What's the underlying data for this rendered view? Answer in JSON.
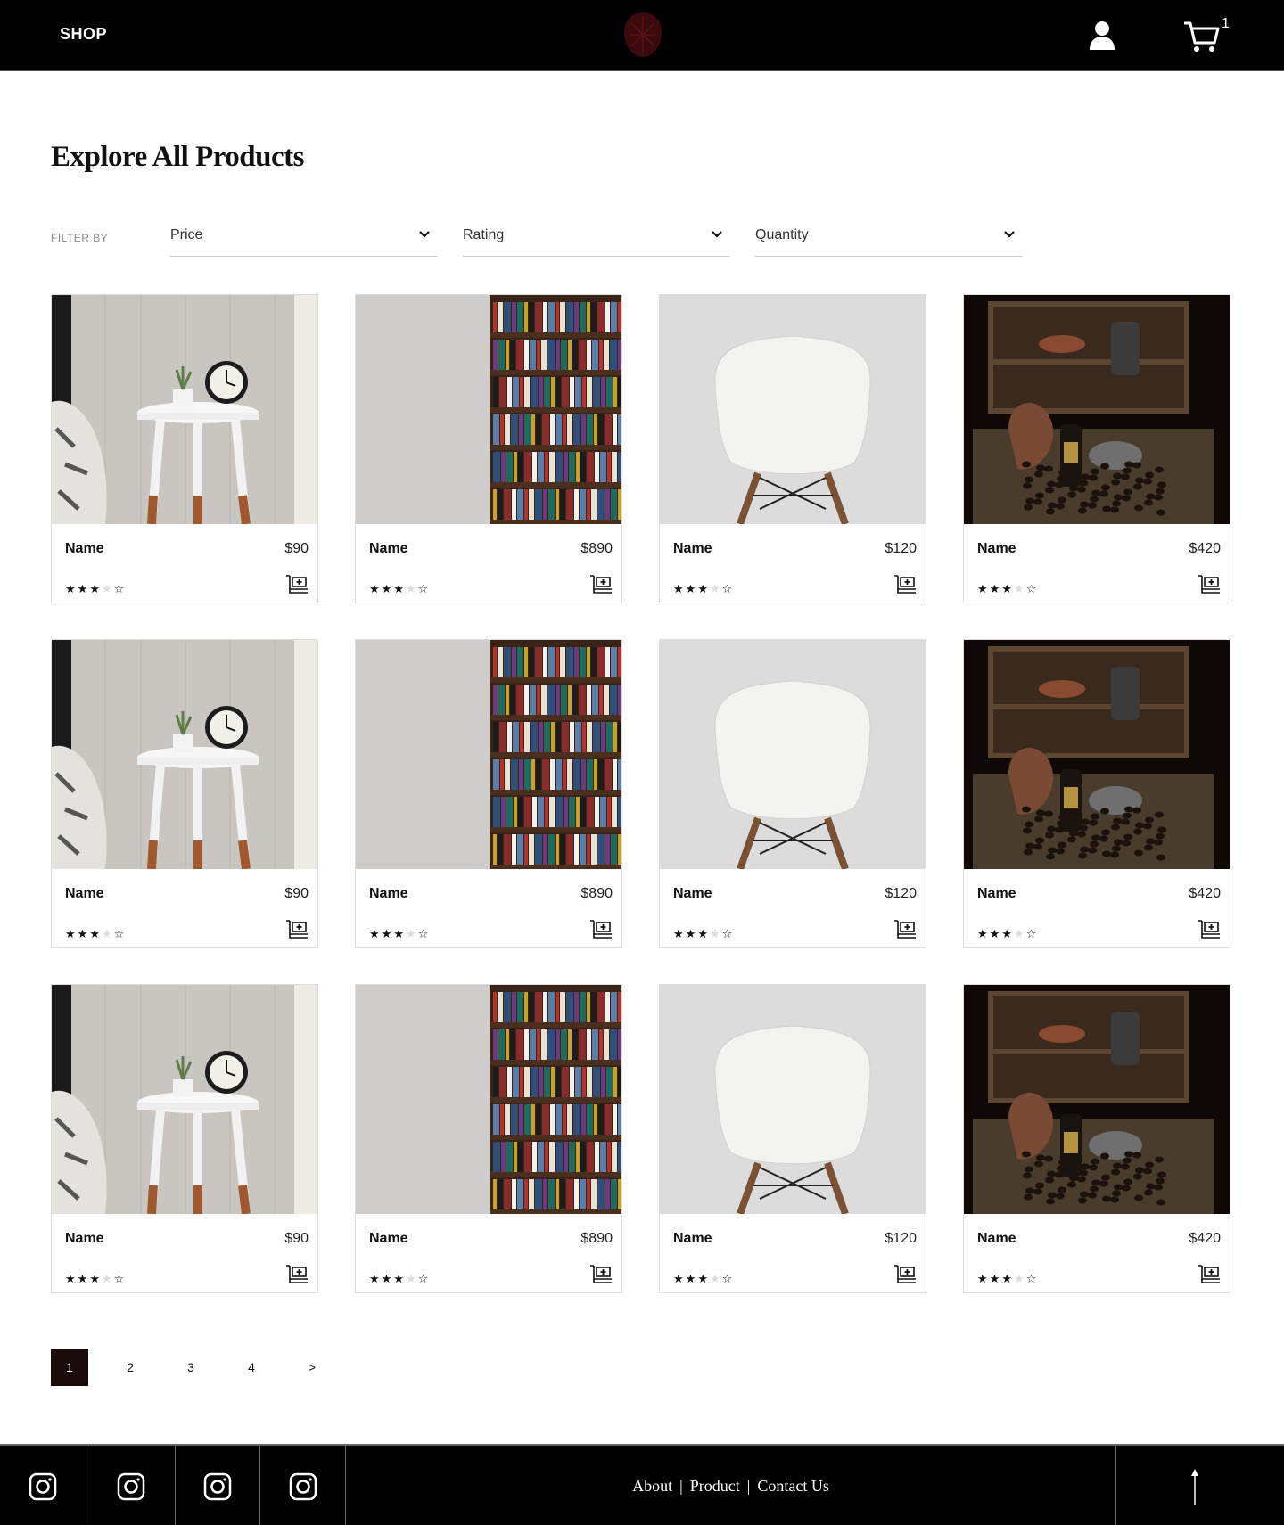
{
  "header": {
    "shop_label": "SHOP",
    "cart_count": "1"
  },
  "page": {
    "title": "Explore All Products"
  },
  "filters": {
    "label": "FILTER BY",
    "items": [
      {
        "label": "Price"
      },
      {
        "label": "Rating"
      },
      {
        "label": "Quantity"
      }
    ]
  },
  "products": {
    "rows": [
      [
        {
          "name": "Name",
          "price": "$90",
          "image": "side-table-clock",
          "rating": 3
        },
        {
          "name": "Name",
          "price": "$890",
          "image": "bookshelf",
          "rating": 3
        },
        {
          "name": "Name",
          "price": "$120",
          "image": "white-chair",
          "rating": 3
        },
        {
          "name": "Name",
          "price": "$420",
          "image": "coffee-crate",
          "rating": 3
        }
      ],
      [
        {
          "name": "Name",
          "price": "$90",
          "image": "side-table-clock",
          "rating": 3
        },
        {
          "name": "Name",
          "price": "$890",
          "image": "bookshelf",
          "rating": 3
        },
        {
          "name": "Name",
          "price": "$120",
          "image": "white-chair",
          "rating": 3
        },
        {
          "name": "Name",
          "price": "$420",
          "image": "coffee-crate",
          "rating": 3
        }
      ],
      [
        {
          "name": "Name",
          "price": "$90",
          "image": "side-table-clock",
          "rating": 3
        },
        {
          "name": "Name",
          "price": "$890",
          "image": "bookshelf",
          "rating": 3
        },
        {
          "name": "Name",
          "price": "$120",
          "image": "white-chair",
          "rating": 3
        },
        {
          "name": "Name",
          "price": "$420",
          "image": "coffee-crate",
          "rating": 3
        }
      ]
    ]
  },
  "pagination": {
    "pages": [
      "1",
      "2",
      "3",
      "4",
      ">"
    ],
    "active": "1"
  },
  "footer": {
    "social_icons": [
      "instagram-icon",
      "instagram-icon",
      "instagram-icon",
      "instagram-icon"
    ],
    "links": {
      "about": "About",
      "product": "Product",
      "contact": "Contact Us",
      "separator": "|"
    }
  },
  "colors": {
    "header_bg": "#000000",
    "pager_active": "#1a0a0a",
    "logo": "#3a0a0e"
  }
}
